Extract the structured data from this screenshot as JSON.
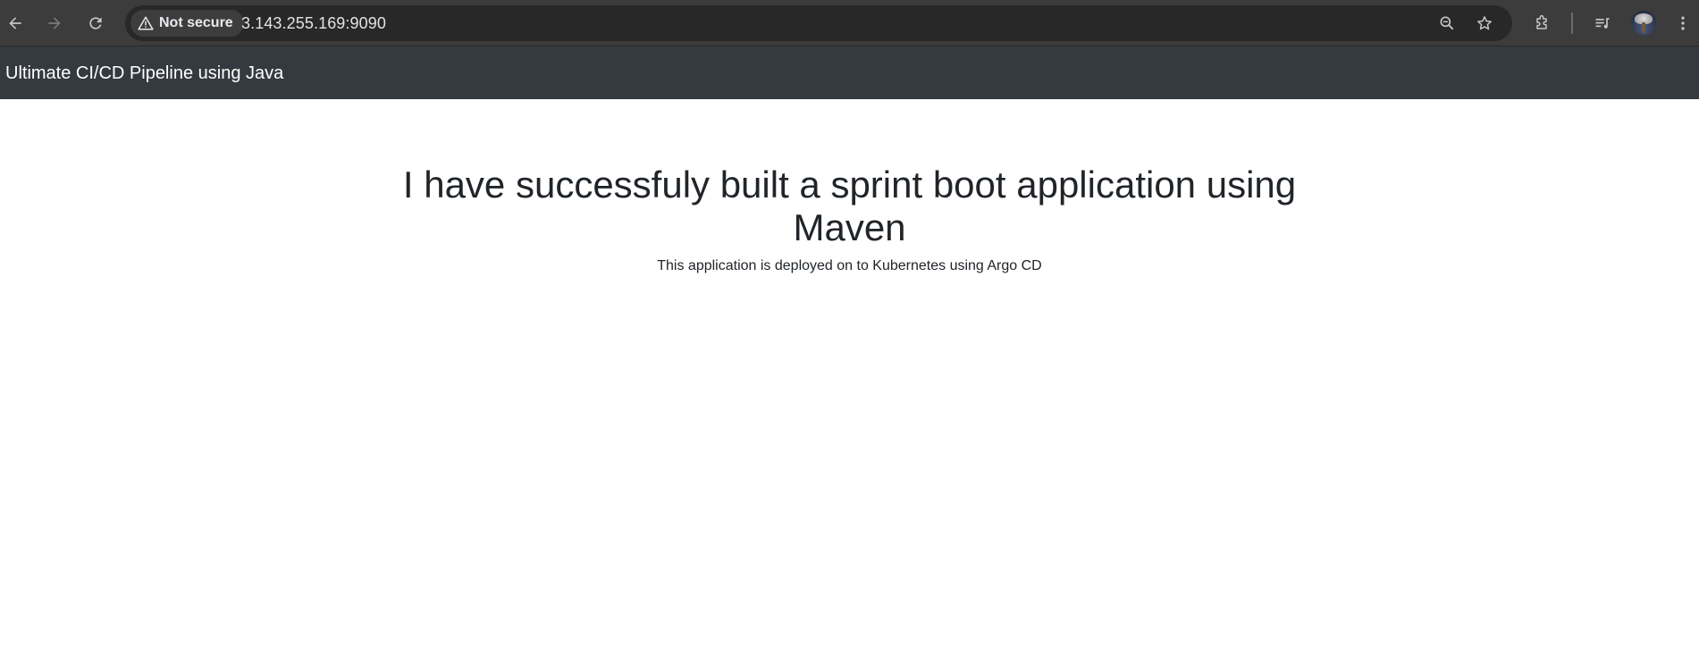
{
  "browser": {
    "security_label": "Not secure",
    "url": "3.143.255.169:9090",
    "icons": {
      "back": "back-arrow-icon",
      "forward": "forward-arrow-icon",
      "reload": "reload-icon",
      "warning": "warning-triangle-icon",
      "zoom": "zoom-out-icon",
      "bookmark": "star-icon",
      "extensions": "puzzle-icon",
      "media": "media-queue-icon",
      "menu": "kebab-menu-icon"
    }
  },
  "navbar": {
    "brand": "Ultimate CI/CD Pipeline using Java"
  },
  "main": {
    "heading": "I have successfuly built a sprint boot application using Maven",
    "subtext": "This application is deployed on to Kubernetes using Argo CD"
  },
  "colors": {
    "toolbar_bg": "#3c3c3c",
    "omnibox_bg": "#282828",
    "navbar_bg": "#343a40",
    "text_dark": "#212529"
  }
}
